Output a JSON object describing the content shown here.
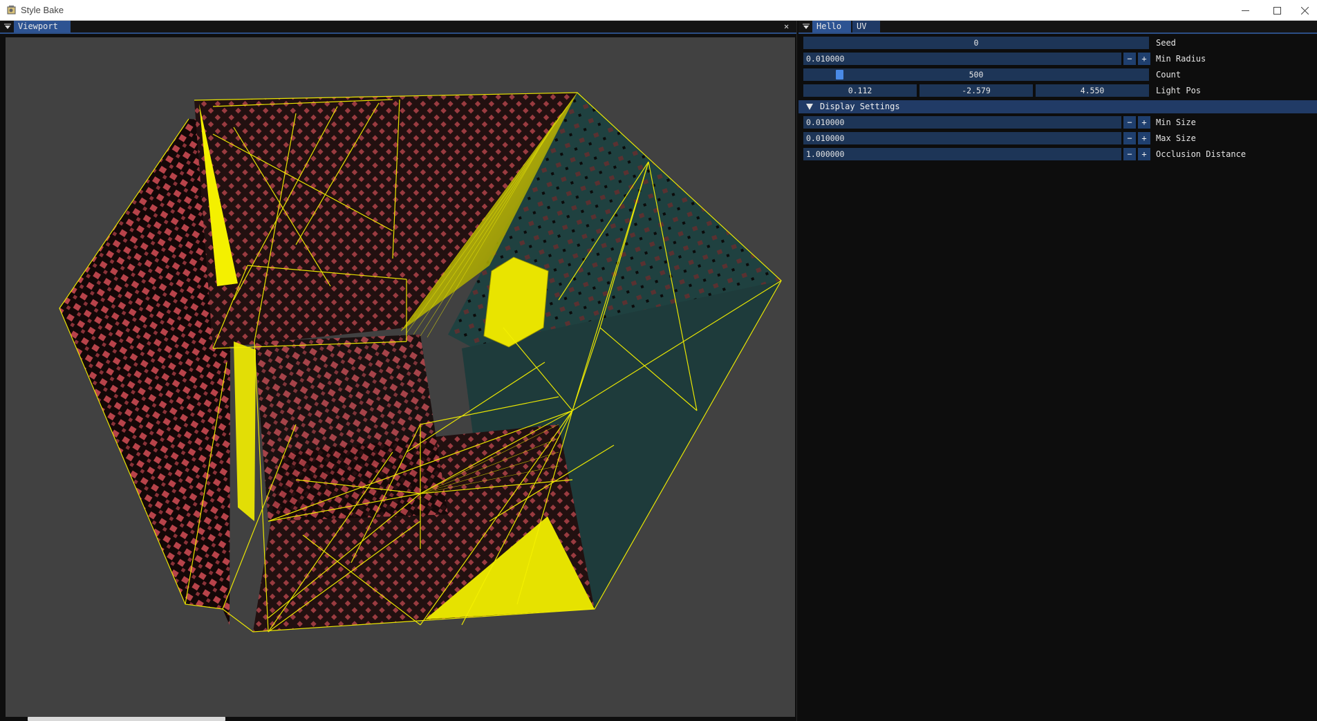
{
  "window": {
    "title": "Style Bake",
    "icons": [
      "app-icon",
      "minimize-icon",
      "maximize-icon",
      "close-icon"
    ]
  },
  "viewport": {
    "tab_label": "Viewport",
    "close_glyph": "✕"
  },
  "panel": {
    "tabs": [
      {
        "label": "Hello"
      },
      {
        "label": "UV"
      }
    ],
    "seed": {
      "value": "0",
      "label": "Seed"
    },
    "min_radius": {
      "value": "0.010000",
      "label": "Min Radius",
      "minus": "−",
      "plus": "+"
    },
    "count": {
      "value": "500",
      "label": "Count",
      "slider_fraction": 0.047
    },
    "light_pos": {
      "x": "0.112",
      "y": "-2.579",
      "z": "4.550",
      "label": "Light Pos"
    },
    "display_settings": {
      "header": "Display Settings",
      "min_size": {
        "value": "0.010000",
        "label": "Min Size",
        "minus": "−",
        "plus": "+"
      },
      "max_size": {
        "value": "0.010000",
        "label": "Max Size",
        "minus": "−",
        "plus": "+"
      },
      "occlusion_distance": {
        "value": "1.000000",
        "label": "Occlusion Distance",
        "minus": "−",
        "plus": "+"
      }
    }
  },
  "colors": {
    "viewport_bg": "#414141",
    "accent_blue": "#2d5392",
    "field_bg": "#1d3557",
    "wire_yellow": "#f4f000",
    "teal_face": "#1f4140",
    "red_tile": "#b8434a"
  }
}
